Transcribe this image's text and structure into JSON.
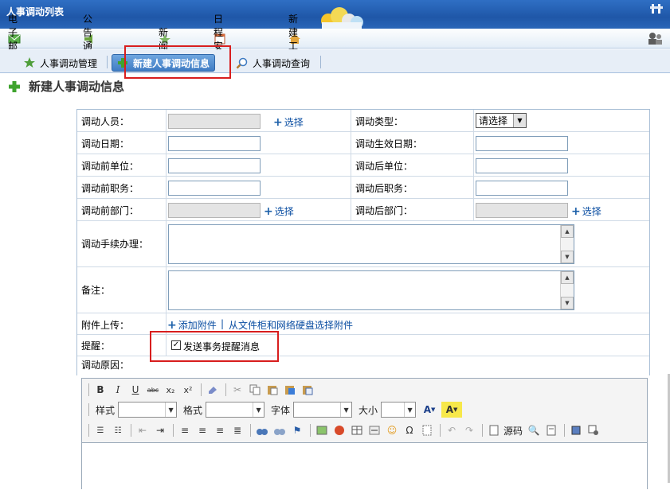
{
  "window": {
    "title": "人事调动列表"
  },
  "menu": [
    {
      "label": "电子邮件",
      "icon": "mail-icon"
    },
    {
      "label": "公告通知",
      "icon": "notice-icon"
    },
    {
      "label": "新闻",
      "icon": "news-icon"
    },
    {
      "label": "日程安排",
      "icon": "calendar-icon"
    },
    {
      "label": "新建工作",
      "icon": "new-work-icon"
    }
  ],
  "tabs": [
    {
      "label": "人事调动管理",
      "icon": "star-icon"
    },
    {
      "label": "新建人事调动信息",
      "icon": "plus-icon",
      "active": true
    },
    {
      "label": "人事调动查询",
      "icon": "search-icon"
    }
  ],
  "page": {
    "title": "新建人事调动信息"
  },
  "form": {
    "person_label": "调动人员：",
    "select_link": "选择",
    "type_label": "调动类型：",
    "type_value": "请选择",
    "date_label": "调动日期：",
    "effective_date_label": "调动生效日期：",
    "before_unit_label": "调动前单位：",
    "after_unit_label": "调动后单位：",
    "before_position_label": "调动前职务：",
    "after_position_label": "调动后职务：",
    "before_dept_label": "调动前部门：",
    "after_dept_label": "调动后部门：",
    "procedure_label": "调动手续办理：",
    "remark_label": "备注：",
    "attachment_label": "附件上传：",
    "add_attachment": "添加附件",
    "attachment_sep": "|",
    "from_cabinet": "从文件柜和网络硬盘选择附件",
    "remind_label": "提醒：",
    "remind_checkbox": "发送事务提醒消息",
    "remind_checked": true,
    "reason_label": "调动原因："
  },
  "editor": {
    "style_label": "样式",
    "format_label": "格式",
    "font_label": "字体",
    "size_label": "大小",
    "source_label": "源码"
  },
  "colors": {
    "highlight": "#d81e1e",
    "link": "#0b4ea2",
    "titlebar": "#1f57a8"
  }
}
